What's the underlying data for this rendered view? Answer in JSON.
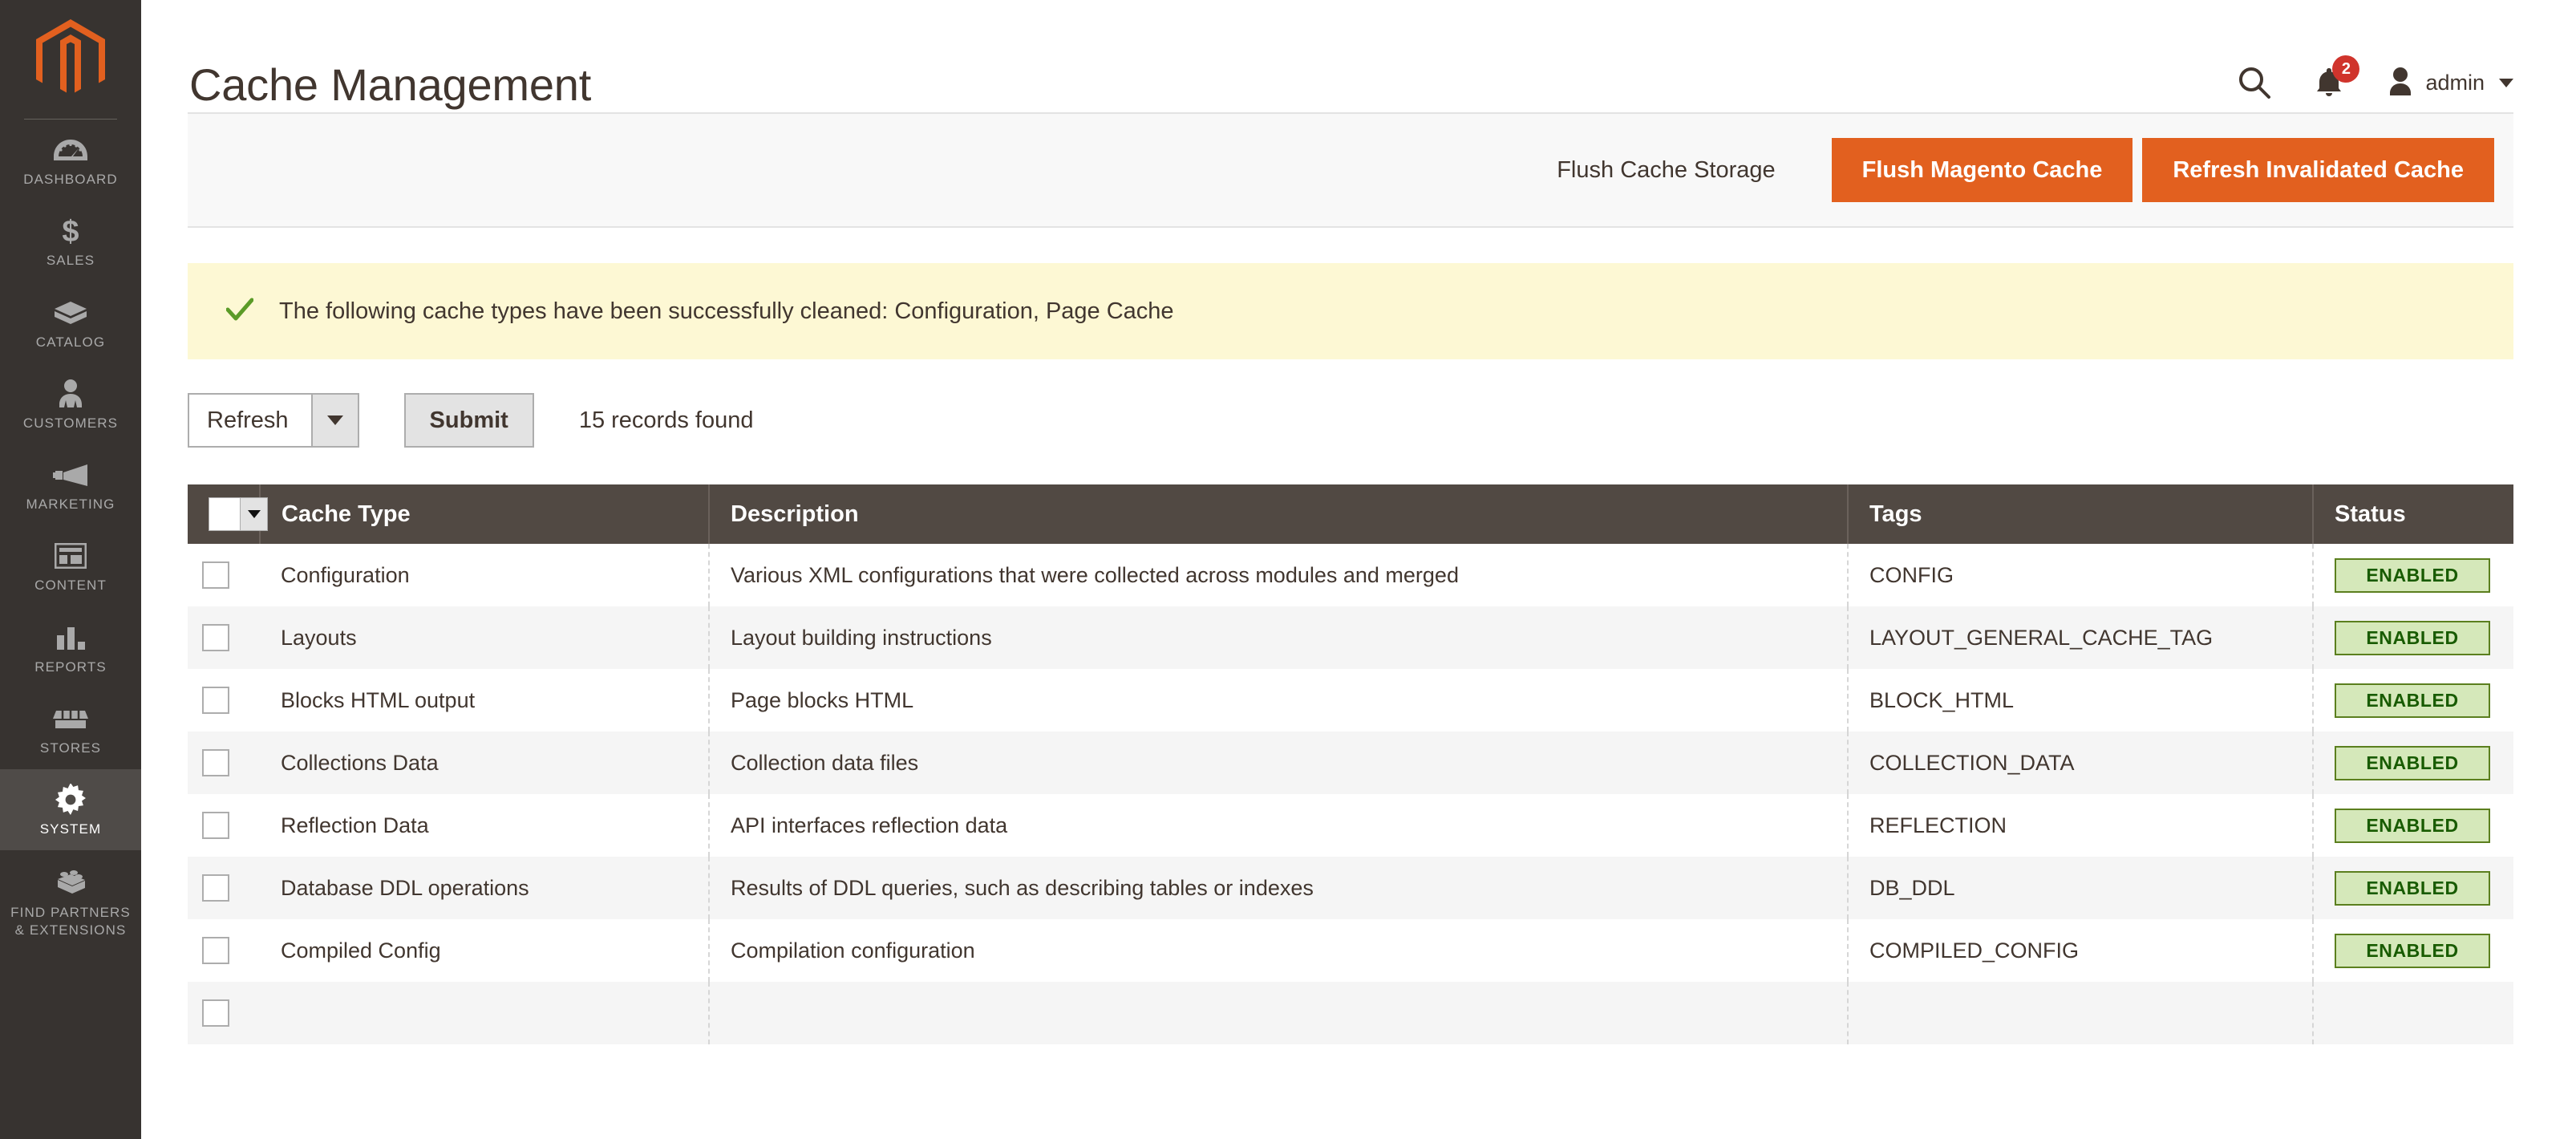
{
  "sidebar": {
    "logo_icon": "magento-logo-icon",
    "items": [
      {
        "label": "DASHBOARD",
        "icon": "dashboard-icon",
        "active": false
      },
      {
        "label": "SALES",
        "icon": "dollar-icon",
        "active": false
      },
      {
        "label": "CATALOG",
        "icon": "box-icon",
        "active": false
      },
      {
        "label": "CUSTOMERS",
        "icon": "person-icon",
        "active": false
      },
      {
        "label": "MARKETING",
        "icon": "megaphone-icon",
        "active": false
      },
      {
        "label": "CONTENT",
        "icon": "layout-icon",
        "active": false
      },
      {
        "label": "REPORTS",
        "icon": "bar-chart-icon",
        "active": false
      },
      {
        "label": "STORES",
        "icon": "storefront-icon",
        "active": false
      },
      {
        "label": "SYSTEM",
        "icon": "gear-icon",
        "active": true
      },
      {
        "label": "FIND PARTNERS\n& EXTENSIONS",
        "icon": "brick-icon",
        "active": false
      }
    ]
  },
  "header": {
    "title": "Cache Management",
    "search_icon": "search-icon",
    "notifications_icon": "bell-icon",
    "notifications_count": "2",
    "avatar_icon": "user-avatar-icon",
    "user_name": "admin",
    "caret_icon": "chevron-down-icon"
  },
  "action_bar": {
    "flush_cache_storage": "Flush Cache Storage",
    "flush_magento_cache": "Flush Magento Cache",
    "refresh_invalidated_cache": "Refresh Invalidated Cache"
  },
  "message": {
    "icon": "check-icon",
    "text": "The following cache types have been successfully cleaned: Configuration, Page Cache"
  },
  "grid_toolbar": {
    "action_select_value": "Refresh",
    "submit_label": "Submit",
    "records_found": "15 records found"
  },
  "grid": {
    "columns": [
      "Cache Type",
      "Description",
      "Tags",
      "Status"
    ],
    "rows": [
      {
        "type": "Configuration",
        "description": "Various XML configurations that were collected across modules and merged",
        "tags": "CONFIG",
        "status": "ENABLED"
      },
      {
        "type": "Layouts",
        "description": "Layout building instructions",
        "tags": "LAYOUT_GENERAL_CACHE_TAG",
        "status": "ENABLED"
      },
      {
        "type": "Blocks HTML output",
        "description": "Page blocks HTML",
        "tags": "BLOCK_HTML",
        "status": "ENABLED"
      },
      {
        "type": "Collections Data",
        "description": "Collection data files",
        "tags": "COLLECTION_DATA",
        "status": "ENABLED"
      },
      {
        "type": "Reflection Data",
        "description": "API interfaces reflection data",
        "tags": "REFLECTION",
        "status": "ENABLED"
      },
      {
        "type": "Database DDL operations",
        "description": "Results of DDL queries, such as describing tables or indexes",
        "tags": "DB_DDL",
        "status": "ENABLED"
      },
      {
        "type": "Compiled Config",
        "description": "Compilation configuration",
        "tags": "COMPILED_CONFIG",
        "status": "ENABLED"
      },
      {
        "type": "",
        "description": "",
        "tags": "",
        "status": ""
      }
    ]
  },
  "colors": {
    "brand_orange": "#e2601f",
    "sidebar_bg": "#373330",
    "sidebar_active_bg": "#4f4b48",
    "table_header_bg": "#514943",
    "success_bg": "#fdf8d4",
    "badge_bg": "#d5e8ba",
    "badge_border": "#5b7f1e",
    "badge_text": "#185b00",
    "notification_badge": "#d0342c"
  }
}
